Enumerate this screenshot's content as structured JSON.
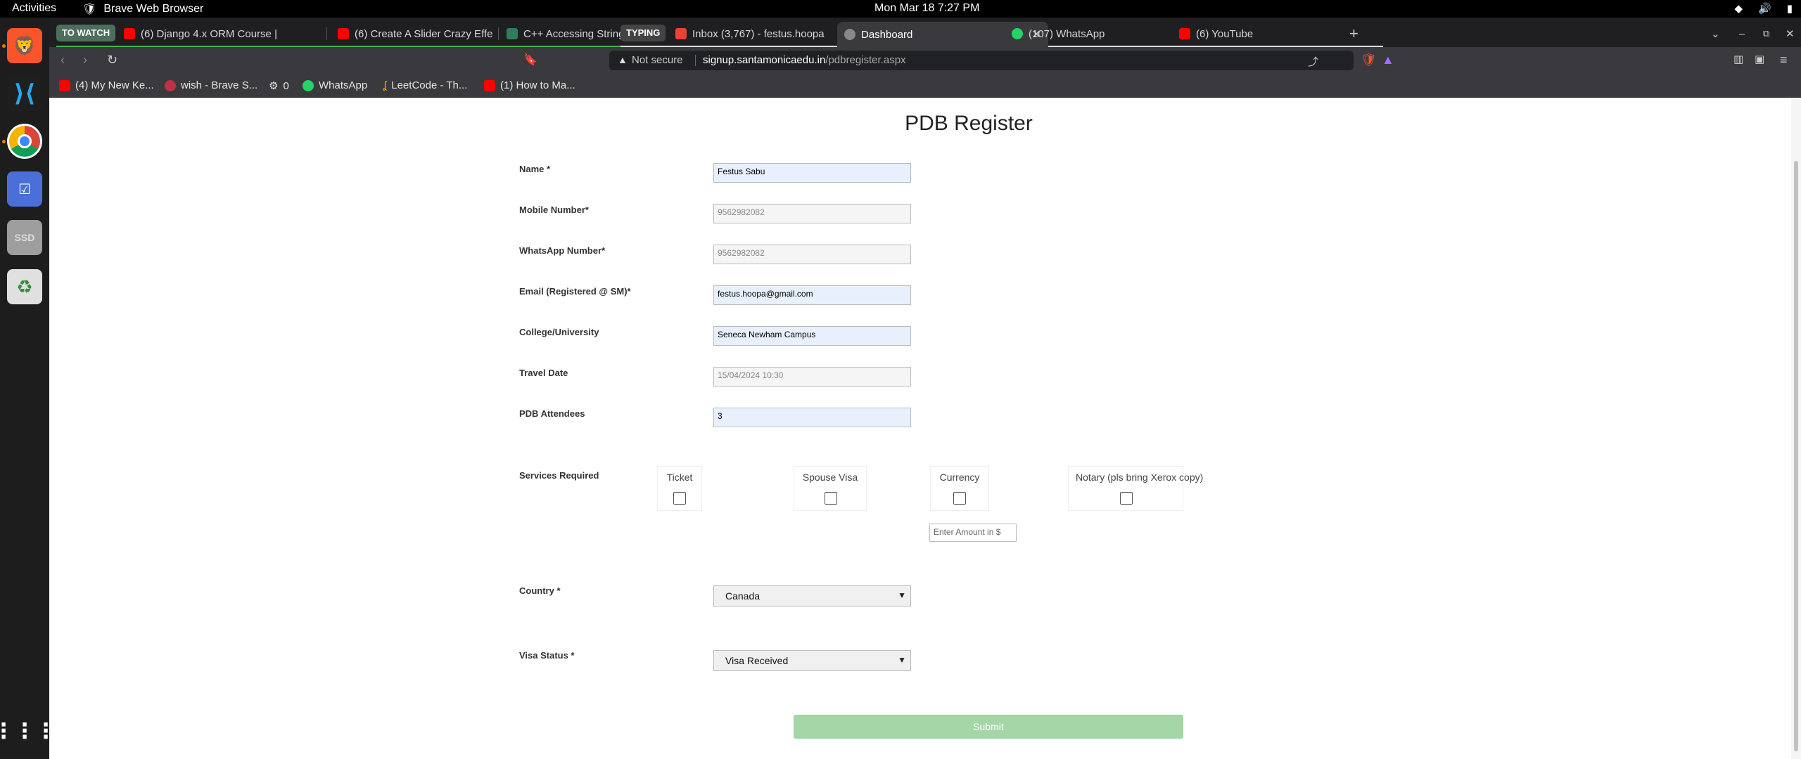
{
  "system": {
    "activities": "Activities",
    "app_name": "Brave Web Browser",
    "clock": "Mon Mar 18  7:27 PM"
  },
  "tabs": {
    "group1": "TO WATCH",
    "t1": "(6) Django 4.x ORM Course |",
    "t2": "(6) Create A Slider Crazy Effe",
    "t3": "C++ Accessing Strings",
    "group2": "TYPING",
    "t4": "Inbox (3,767) - festus.hoopa",
    "t5": "Dashboard",
    "t6": "(107) WhatsApp",
    "t7": "(6) YouTube",
    "new_tab": "+"
  },
  "address": {
    "security": "Not secure",
    "host": "signup.santamonicaedu.in",
    "path": "/pdbregister.aspx"
  },
  "bookmarks": {
    "b1": "(4) My New Ke...",
    "b2": "wish - Brave S...",
    "b3": "0",
    "b4": "WhatsApp",
    "b5": "LeetCode - Th...",
    "b6": "(1) How to Ma..."
  },
  "form": {
    "title": "PDB Register",
    "name_label": "Name *",
    "name_value": "Festus Sabu",
    "mobile_label": "Mobile Number*",
    "mobile_value": "9562982082",
    "whatsapp_label": "WhatsApp Number*",
    "whatsapp_value": "9562982082",
    "email_label": "Email (Registered @ SM)*",
    "email_value": "festus.hoopa@gmail.com",
    "college_label": "College/University",
    "college_value": "Seneca Newham Campus",
    "travel_label": "Travel Date",
    "travel_value": "15/04/2024 10:30",
    "attendees_label": "PDB Attendees",
    "attendees_value": "3",
    "services_label": "Services Required",
    "svc_ticket": "Ticket",
    "svc_spouse": "Spouse Visa",
    "svc_currency": "Currency",
    "svc_notary": "Notary (pls bring Xerox copy)",
    "amount_placeholder": "Enter Amount in $",
    "country_label": "Country *",
    "country_value": "Canada",
    "visa_label": "Visa Status *",
    "visa_value": "Visa Received",
    "submit_label": "Submit"
  }
}
